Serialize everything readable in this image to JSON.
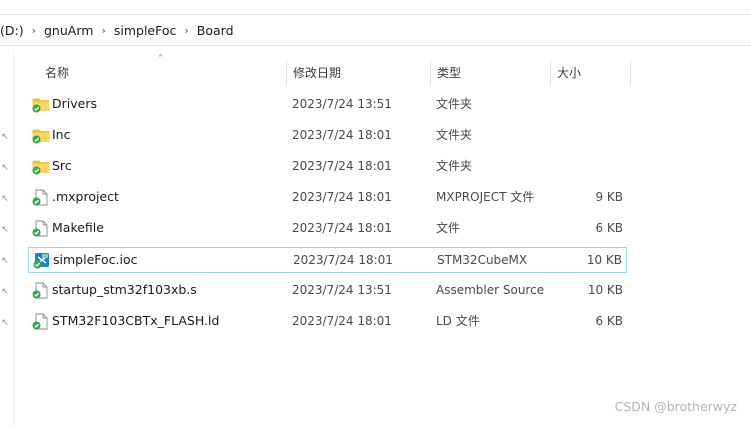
{
  "breadcrumb": [
    "(D:)",
    "gnuArm",
    "simpleFoc",
    "Board"
  ],
  "columns": {
    "name": "名称",
    "date": "修改日期",
    "type": "类型",
    "size": "大小"
  },
  "files": [
    {
      "name": "Drivers",
      "date": "2023/7/24 13:51",
      "type": "文件夹",
      "size": "",
      "icon": "folder-icon"
    },
    {
      "name": "Inc",
      "date": "2023/7/24 18:01",
      "type": "文件夹",
      "size": "",
      "icon": "folder-icon"
    },
    {
      "name": "Src",
      "date": "2023/7/24 18:01",
      "type": "文件夹",
      "size": "",
      "icon": "folder-icon"
    },
    {
      "name": ".mxproject",
      "date": "2023/7/24 18:01",
      "type": "MXPROJECT 文件",
      "size": "9 KB",
      "icon": "file-icon"
    },
    {
      "name": "Makefile",
      "date": "2023/7/24 18:01",
      "type": "文件",
      "size": "6 KB",
      "icon": "file-icon"
    },
    {
      "name": "simpleFoc.ioc",
      "date": "2023/7/24 18:01",
      "type": "STM32CubeMX",
      "size": "10 KB",
      "icon": "cubemx-icon"
    },
    {
      "name": "startup_stm32f103xb.s",
      "date": "2023/7/24 13:51",
      "type": "Assembler Source",
      "size": "10 KB",
      "icon": "file-icon"
    },
    {
      "name": "STM32F103CBTx_FLASH.ld",
      "date": "2023/7/24 18:01",
      "type": "LD 文件",
      "size": "6 KB",
      "icon": "file-icon"
    }
  ],
  "selected_index": 5,
  "watermark": "CSDN @brotherwyz",
  "colors": {
    "selection_border": "#99d1ff",
    "folder": "#f5c842",
    "sync_check": "#2fa84f"
  }
}
